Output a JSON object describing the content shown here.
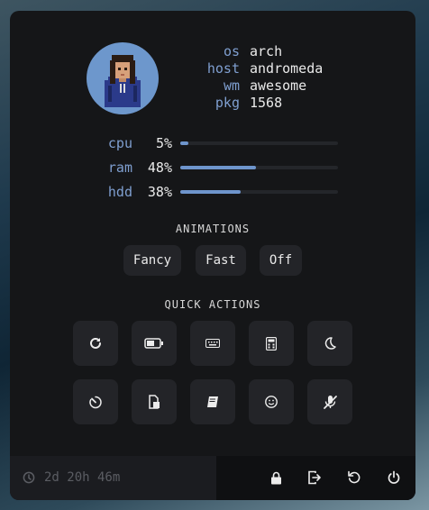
{
  "info": {
    "rows": [
      {
        "key": "os",
        "value": "arch"
      },
      {
        "key": "host",
        "value": "andromeda"
      },
      {
        "key": "wm",
        "value": "awesome"
      },
      {
        "key": "pkg",
        "value": "1568"
      }
    ]
  },
  "stats": [
    {
      "label": "cpu",
      "value": "5%",
      "percent": 5
    },
    {
      "label": "ram",
      "value": "48%",
      "percent": 48
    },
    {
      "label": "hdd",
      "value": "38%",
      "percent": 38
    }
  ],
  "animations": {
    "title": "ANIMATIONS",
    "options": [
      "Fancy",
      "Fast",
      "Off"
    ]
  },
  "quick_actions": {
    "title": "QUICK ACTIONS",
    "icons": [
      "refresh-icon",
      "battery-icon",
      "keyboard-icon",
      "calculator-icon",
      "moon-icon",
      "timer-icon",
      "screenshot-icon",
      "book-icon",
      "smiley-icon",
      "mute-microphone-icon"
    ]
  },
  "footer": {
    "uptime": "2d 20h 46m",
    "power_icons": [
      "moon-icon",
      "lock-icon",
      "logout-icon",
      "reboot-icon",
      "power-icon"
    ]
  },
  "colors": {
    "accent": "#7f9fd0",
    "bar_fill": "#6e95cc",
    "panel_bg": "#151618",
    "button_bg": "#232428"
  }
}
